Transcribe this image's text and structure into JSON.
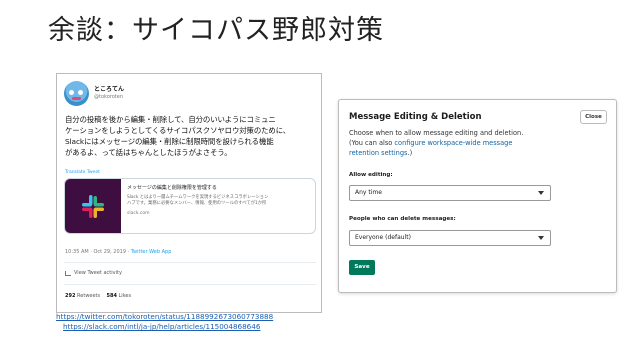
{
  "slide": {
    "title": "余談：サイコパス野郎対策"
  },
  "tweet": {
    "user_name": "ところてん",
    "user_handle": "@tokoroten",
    "body_lines": [
      "自分の投稿を後から編集・削除して、自分のいいようにコミュニ",
      "ケーションをしようとしてくるサイコパスクソヤロウ対策のために、",
      "Slackにはメッセージの編集・削除に制限時間を設けられる機能",
      "があるよ、って話はちゃんとしたほうがよさそう。"
    ],
    "translate_label": "Translate Tweet",
    "card": {
      "title": "メッセージの編集と削除権限を管理する",
      "desc_lines": [
        "Slack とはより一層ムチームワークを実現するビジネスコラボレーション",
        "ハブです。業務に必要なメンバー、情報、使用のツールのすべてが1か所"
      ],
      "domain": "slack.com"
    },
    "meta_time": "10:35 AM · Oct 29, 2019 · ",
    "meta_app": "Twitter Web App",
    "activity_label": "View Tweet activity",
    "retweets_count": "292",
    "retweets_label": "Retweets",
    "likes_count": "584",
    "likes_label": "Likes"
  },
  "sources": {
    "link1": "https://twitter.com/tokoroten/status/1188992673060773888",
    "link2": "https://slack.com/intl/ja-jp/help/articles/115004868646"
  },
  "dialog": {
    "title": "Message Editing & Deletion",
    "close_label": "Close",
    "desc_line1": "Choose when to allow message editing and deletion.",
    "desc_line2_prefix": "(You can also ",
    "desc_link_part1": "configure workspace-wide message",
    "desc_link_part2": "retention settings",
    "desc_line3_suffix": ".)",
    "allow_editing_label": "Allow editing:",
    "allow_editing_value": "Any time",
    "delete_label": "People who can delete messages:",
    "delete_value": "Everyone (default)",
    "save_label": "Save"
  },
  "colors": {
    "slack_green": "#007a5a",
    "link_blue": "#1264a3",
    "twitter_blue": "#1da1f2",
    "slack_aubergine": "#3f0e40"
  },
  "icons": {
    "dropdown": "chevron-down-icon",
    "activity": "bar-chart-icon",
    "slack": "slack-logo-icon"
  }
}
